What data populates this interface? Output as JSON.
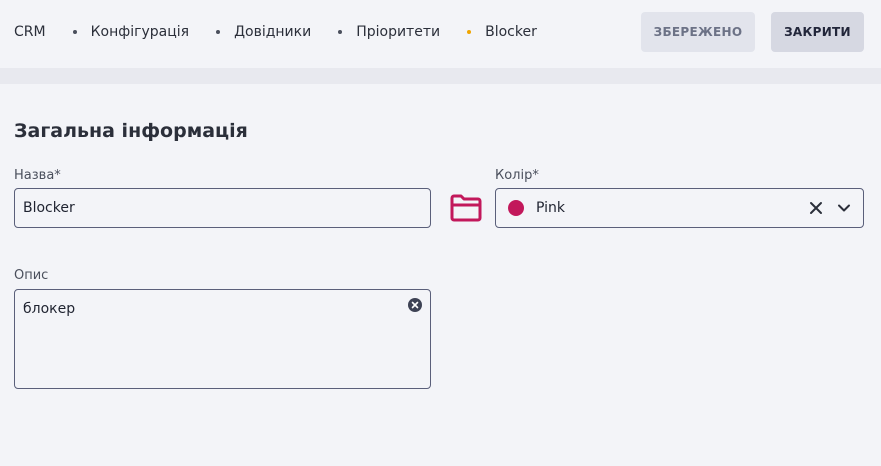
{
  "breadcrumb": [
    "CRM",
    "Конфігурація",
    "Довідники",
    "Пріоритети",
    "Blocker"
  ],
  "toolbar": {
    "saved_label": "ЗБЕРЕЖЕНО",
    "close_label": "ЗАКРИТИ"
  },
  "section": {
    "title": "Загальна інформація"
  },
  "form": {
    "name_label": "Назва*",
    "name_value": "Blocker",
    "color_label": "Колір*",
    "color_value": "Pink",
    "color_hex": "#c2185b",
    "description_label": "Опис",
    "description_value": "блокер"
  },
  "colors": {
    "accent": "#c2185b",
    "active_crumb_dot": "#f0a500"
  }
}
